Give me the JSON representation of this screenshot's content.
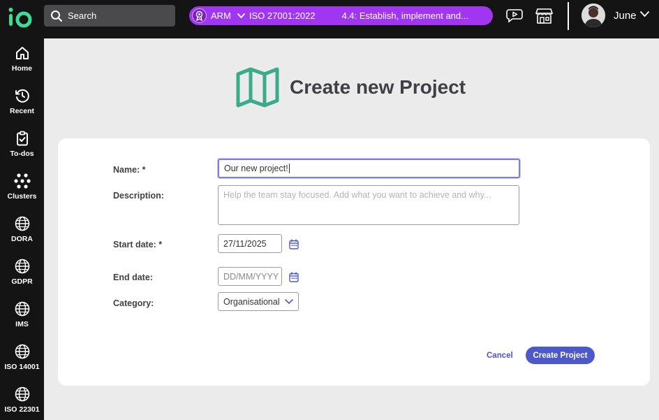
{
  "topbar": {
    "logo_text": "io",
    "search_label": "Search",
    "context": {
      "org": "ARM",
      "standard": "ISO 27001:2022",
      "clause": "4.4: Establish, implement and..."
    },
    "user_name": "June"
  },
  "sidebar": {
    "items": [
      {
        "label": "Home",
        "icon": "home-icon"
      },
      {
        "label": "Recent",
        "icon": "history-icon"
      },
      {
        "label": "To-dos",
        "icon": "clipboard-check-icon"
      },
      {
        "label": "Clusters",
        "icon": "clusters-icon"
      },
      {
        "label": "DORA",
        "icon": "globe-icon"
      },
      {
        "label": "GDPR",
        "icon": "globe-icon"
      },
      {
        "label": "IMS",
        "icon": "globe-icon"
      },
      {
        "label": "ISO 14001",
        "icon": "globe-icon"
      },
      {
        "label": "ISO 22301",
        "icon": "globe-icon"
      }
    ]
  },
  "page": {
    "title": "Create new Project",
    "icon": "map-icon"
  },
  "form": {
    "name_label": "Name: *",
    "name_value": "Our new project!",
    "description_label": "Description:",
    "description_placeholder": "Help the team stay focused. Add what you want to achieve and why...",
    "start_label": "Start date: *",
    "start_value": "27/11/2025",
    "end_label": "End date:",
    "end_placeholder": "DD/MM/YYYY",
    "category_label": "Category:",
    "category_value": "Organisational",
    "cancel_label": "Cancel",
    "create_label": "Create Project"
  },
  "colors": {
    "accent": "#4c59c9",
    "context_pill": "#a136f2",
    "logo": "#3ddc97",
    "map_icon": "#3aab8a"
  }
}
